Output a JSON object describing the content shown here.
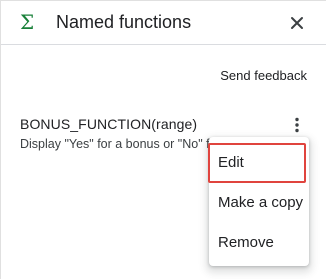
{
  "header": {
    "title": "Named functions",
    "icon": "sigma-icon",
    "close_icon": "close-icon"
  },
  "send_feedback": "Send feedback",
  "function": {
    "name": "BONUS_FUNCTION(range)",
    "description": "Display \"Yes\" for a bonus or \"No\" for no bonus",
    "more_icon": "more-vert-icon"
  },
  "menu": {
    "items": [
      {
        "label": "Edit",
        "highlighted": true
      },
      {
        "label": "Make a copy",
        "highlighted": false
      },
      {
        "label": "Remove",
        "highlighted": false
      }
    ]
  },
  "colors": {
    "sigma": "#188038",
    "highlight_border": "#e0443e",
    "text": "#202124"
  }
}
